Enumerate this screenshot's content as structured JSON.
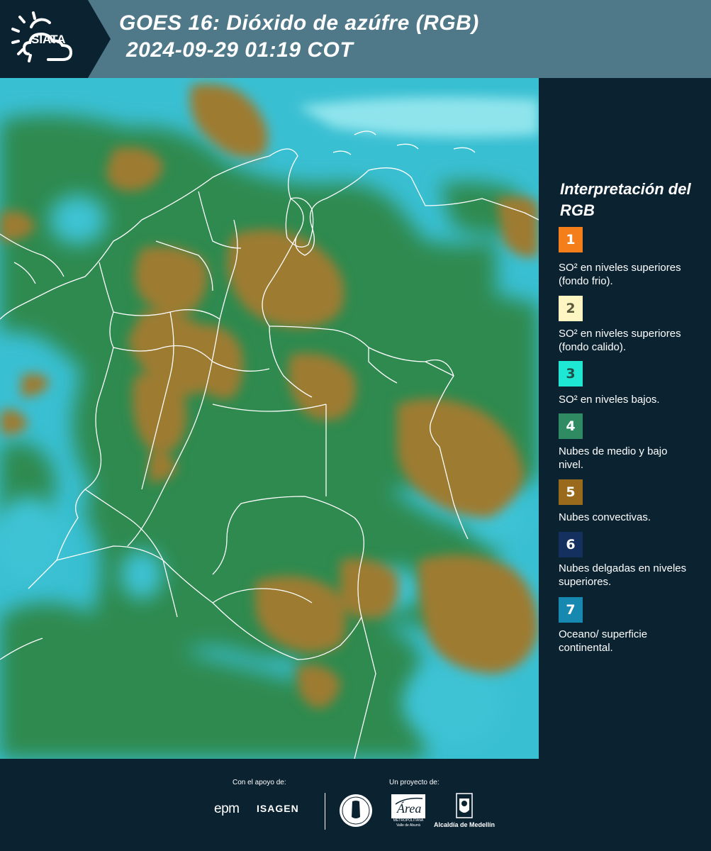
{
  "header": {
    "logo_text": "SIATA",
    "title_line1": "GOES 16: Dióxido de azúfre (RGB)",
    "title_line2": "2024-09-29 01:19 COT"
  },
  "map": {
    "colors": {
      "ocean_cyan": "#3fc6d6",
      "cloud_green": "#2f8d52",
      "convective_brown": "#9c7a33",
      "boundary_white": "#ffffff"
    }
  },
  "legend": {
    "title": "Interpretación del RGB",
    "items": [
      {
        "number": "1",
        "color": "#f47f1a",
        "text_color": "#ffffff",
        "label": "SO² en niveles superiores (fondo frio)."
      },
      {
        "number": "2",
        "color": "#fdf6c3",
        "text_color": "#5a5a3a",
        "label": "SO² en niveles superiores (fondo calido)."
      },
      {
        "number": "3",
        "color": "#1ee8d3",
        "text_color": "#1f4f4a",
        "label": "SO² en niveles bajos."
      },
      {
        "number": "4",
        "color": "#2e8b62",
        "text_color": "#ffffff",
        "label": "Nubes de medio y bajo nivel."
      },
      {
        "number": "5",
        "color": "#9a6a1c",
        "text_color": "#ffffff",
        "label": "Nubes convectivas."
      },
      {
        "number": "6",
        "color": "#14305e",
        "text_color": "#ffffff",
        "label": "Nubes delgadas en niveles superiores."
      },
      {
        "number": "7",
        "color": "#1789b0",
        "text_color": "#ffffff",
        "label": "Oceano/ superficie continental."
      }
    ]
  },
  "footer": {
    "support_label": "Con el apoyo de:",
    "project_label": "Un proyecto de:",
    "epm_logo_text": "epm",
    "isagen_logo_text": "ISAGEN",
    "area_logo_text": "Área",
    "area_logo_name": "METROPOLITANA",
    "area_logo_sub": "Valle de Aburrá",
    "alcaldia_label": "Alcaldía de Medellín"
  }
}
